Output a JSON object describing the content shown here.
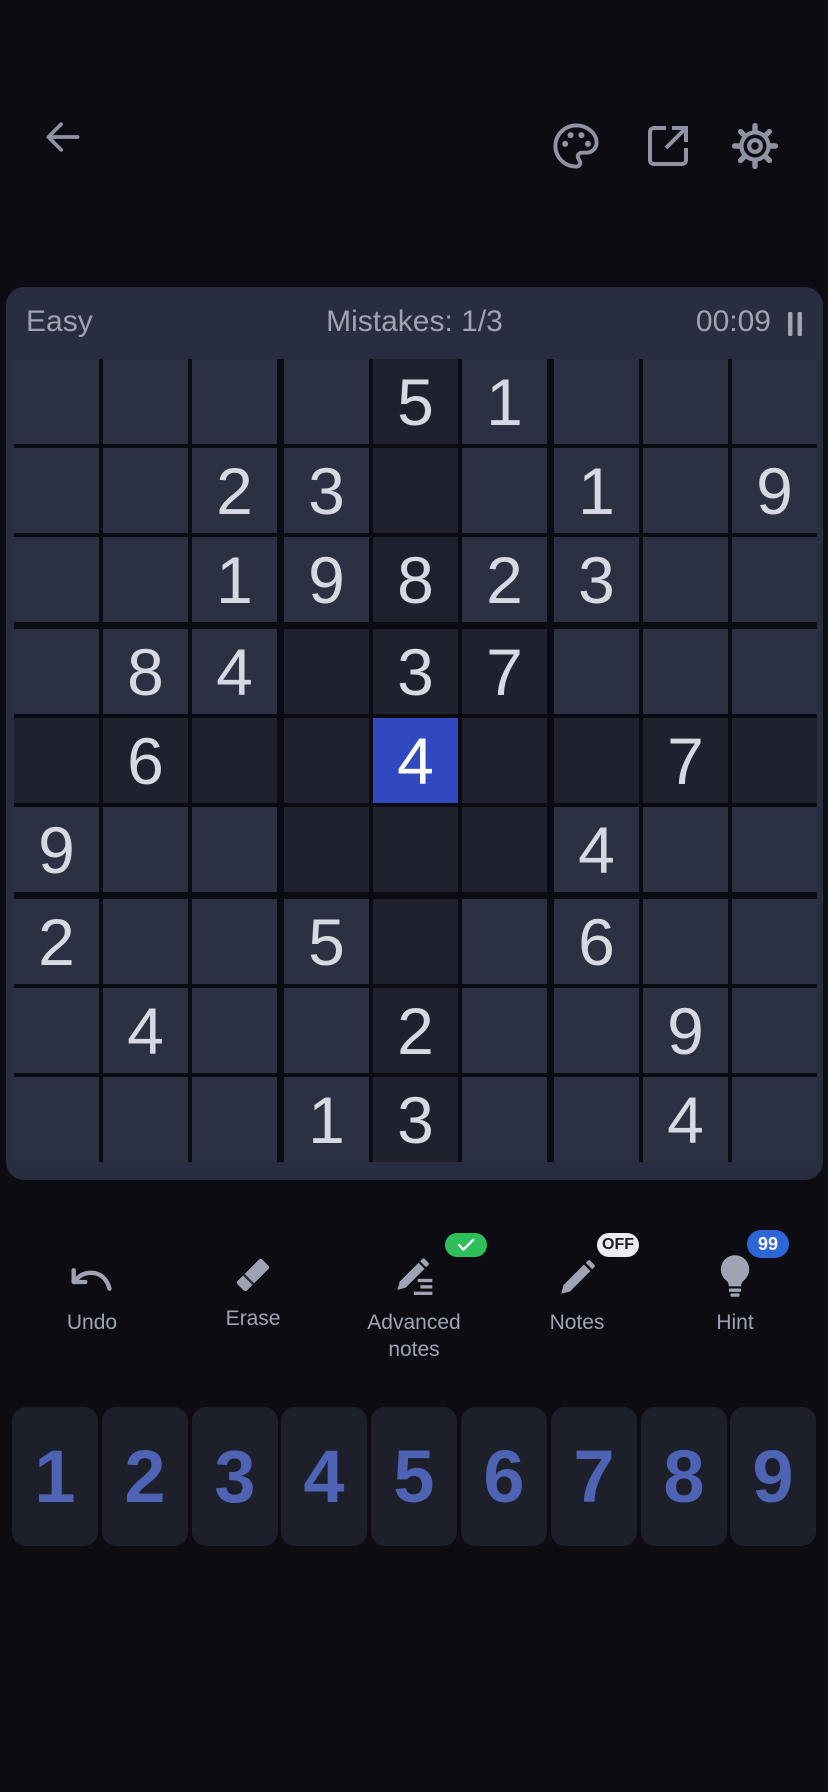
{
  "header": {
    "back_icon": "arrow-left-icon",
    "actions": [
      "palette-icon",
      "share-icon",
      "settings-icon"
    ]
  },
  "status": {
    "difficulty": "Easy",
    "mistakes": "Mistakes: 1/3",
    "timer": "00:09"
  },
  "board": {
    "grid": [
      [
        "",
        "",
        "",
        "",
        "5",
        "1",
        "",
        "",
        ""
      ],
      [
        "",
        "",
        "2",
        "3",
        "",
        "",
        "1",
        "",
        "9"
      ],
      [
        "",
        "",
        "1",
        "9",
        "8",
        "2",
        "3",
        "",
        ""
      ],
      [
        "",
        "8",
        "4",
        "",
        "3",
        "7",
        "",
        "",
        ""
      ],
      [
        "",
        "6",
        "",
        "",
        "4",
        "",
        "",
        "7",
        ""
      ],
      [
        "9",
        "",
        "",
        "",
        "",
        "",
        "4",
        "",
        ""
      ],
      [
        "2",
        "",
        "",
        "5",
        "",
        "",
        "6",
        "",
        ""
      ],
      [
        "",
        "4",
        "",
        "",
        "2",
        "",
        "",
        "9",
        ""
      ],
      [
        "",
        "",
        "",
        "1",
        "3",
        "",
        "",
        "4",
        ""
      ]
    ],
    "selected": [
      4,
      4
    ],
    "colors": {
      "cell": "#2b3042",
      "highlight": "#1f222e",
      "selected": "#2f4ac1"
    }
  },
  "tools": {
    "undo": "Undo",
    "erase": "Erase",
    "advanced_notes": "Advanced notes",
    "notes": "Notes",
    "notes_badge": "OFF",
    "hint": "Hint",
    "hint_badge": "99"
  },
  "numpad": [
    "1",
    "2",
    "3",
    "4",
    "5",
    "6",
    "7",
    "8",
    "9"
  ]
}
